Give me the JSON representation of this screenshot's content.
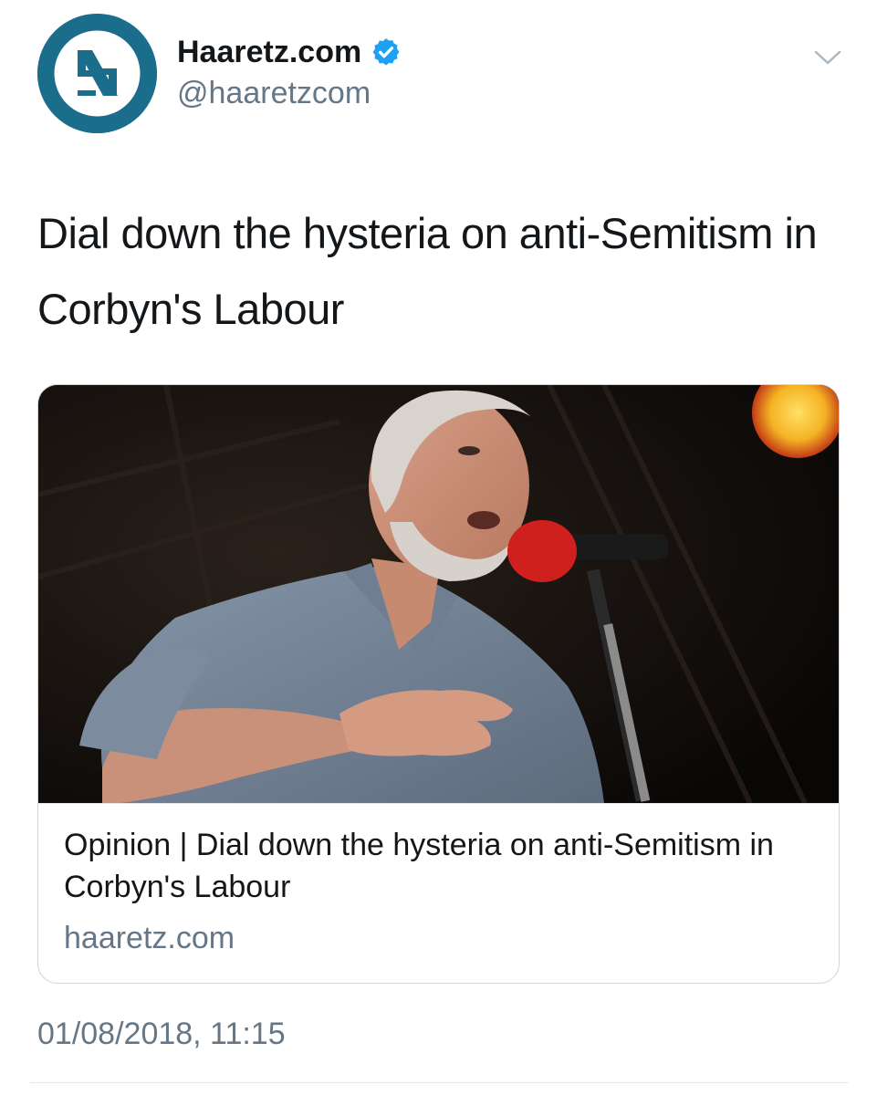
{
  "author": {
    "display_name": "Haaretz.com",
    "handle": "@haaretzcom",
    "verified": true,
    "avatar_icon": "haaretz-logo",
    "avatar_color": "#1b6d8c",
    "verified_color": "#1da1f2"
  },
  "menu_icon": "chevron-down-icon",
  "tweet": {
    "text": "Dial down the hysteria on anti-Semitism in Corbyn's Labour"
  },
  "card": {
    "image_icon": "photo-man-speaking-at-microphone",
    "title": "Opinion | Dial down the hysteria on anti-Semitism in Corbyn's Labour",
    "domain": "haaretz.com"
  },
  "timestamp": "01/08/2018, 11:15",
  "colors": {
    "text_primary": "#14171a",
    "text_secondary": "#657786",
    "border": "#ccd6dd"
  }
}
